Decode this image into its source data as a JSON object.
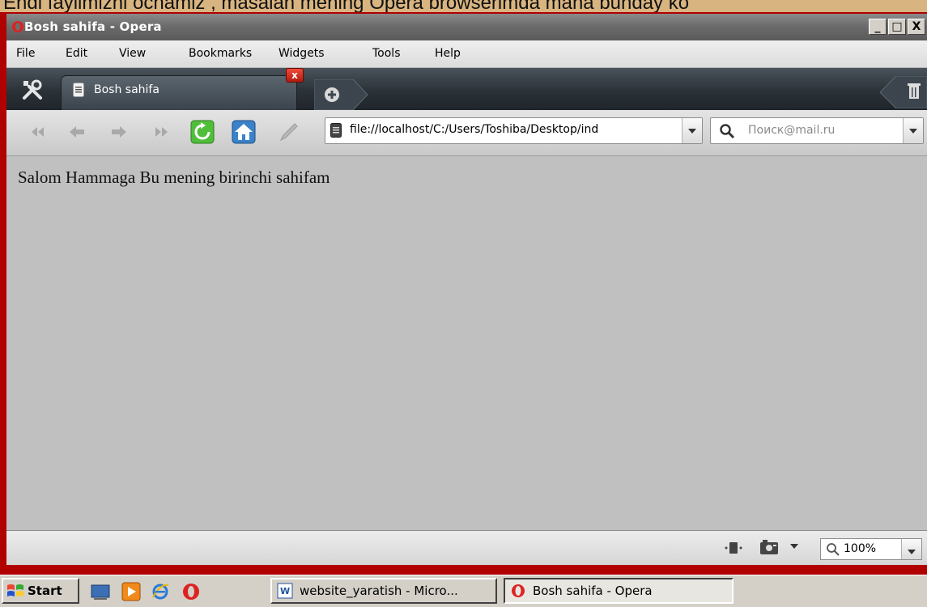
{
  "caption": "Endi faylimizni ochamiz , masalan mening Opera browserimda mana bunday ko",
  "window": {
    "title": "Bosh sahifa - Opera",
    "controls": [
      "_",
      "□",
      "X"
    ]
  },
  "menu": [
    "File",
    "Edit",
    "View",
    "Bookmarks",
    "Widgets",
    "Tools",
    "Help"
  ],
  "tabs": {
    "active_label": "Bosh sahifa",
    "close_label": "x"
  },
  "navigation": {
    "address": "file://localhost/C:/Users/Toshiba/Desktop/ind",
    "search_placeholder": "Поиск@mail.ru"
  },
  "page": {
    "text": "Salom Hammaga Bu mening birinchi sahifam"
  },
  "statusbar": {
    "zoom": "100%"
  },
  "taskbar": {
    "start_label": "Start",
    "items": [
      {
        "label": "website_yaratish - Micro..."
      },
      {
        "label": "Bosh sahifa - Opera"
      }
    ]
  },
  "colors": {
    "frame": "#b00000",
    "content_bg": "#c0c0c0",
    "tabbar": "#2b3238"
  }
}
